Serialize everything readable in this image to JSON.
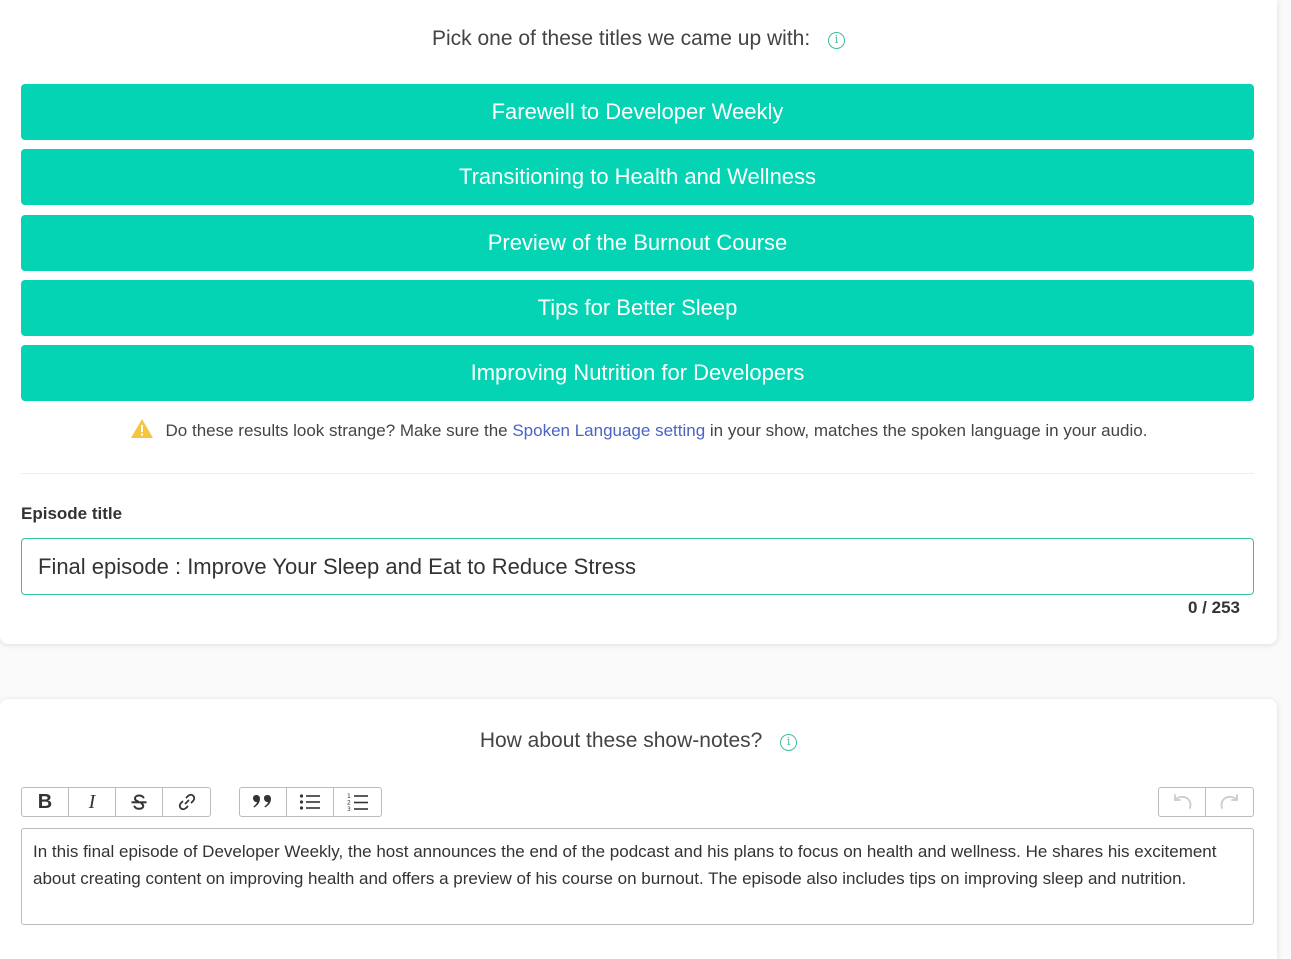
{
  "titles_section": {
    "heading": "Pick one of these titles we came up with:",
    "info_icon": "i",
    "options": [
      "Farewell to Developer Weekly",
      "Transitioning to Health and Wellness",
      "Preview of the Burnout Course",
      "Tips for Better Sleep",
      "Improving Nutrition for Developers"
    ],
    "warning": {
      "prefix": "Do these results look strange? Make sure the ",
      "link": "Spoken Language setting",
      "suffix": " in your show, matches the spoken language in your audio."
    }
  },
  "episode_title": {
    "label": "Episode title",
    "value": "Final episode : Improve Your Sleep and Eat to Reduce Stress",
    "char_count": "0 / 253"
  },
  "shownotes_section": {
    "heading": "How about these show-notes?",
    "info_icon": "i",
    "toolbar": {
      "bold": "B",
      "italic": "I"
    },
    "content": "In this final episode of Developer Weekly, the host announces the end of the podcast and his plans to focus on health and wellness. He shares his excitement about creating content on improving health and offers a preview of his course on burnout. The episode also includes tips on improving sleep and nutrition."
  },
  "colors": {
    "accent": "#04d4b4",
    "info": "#3cbf9b",
    "link": "#4a63c5",
    "warning": "#f5c542"
  }
}
